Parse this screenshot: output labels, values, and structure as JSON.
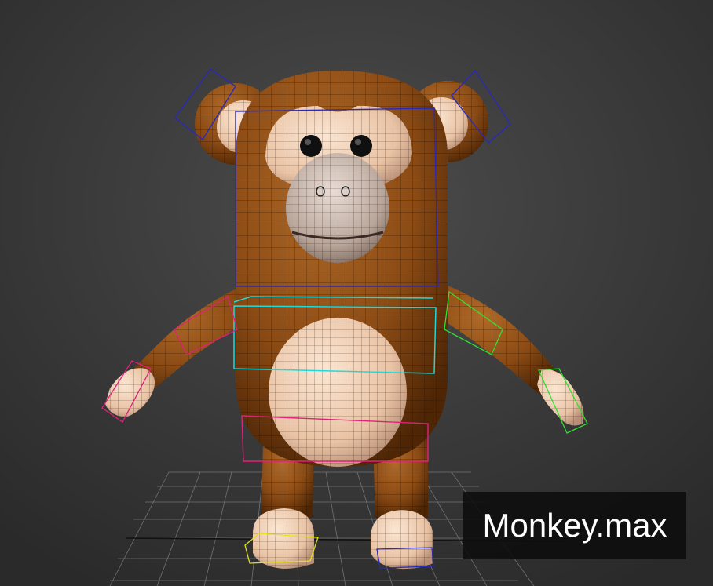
{
  "scene": {
    "file_name": "Monkey.max",
    "object": "monkey-character",
    "colors": {
      "background_top": "#4a4a4a",
      "background_bottom": "#2c2c2c",
      "fur": "#8a4a14",
      "fur_dark": "#5a2c08",
      "skin": "#f4d2b4",
      "skin_shade": "#c89f86",
      "eye": "#111111",
      "bone_blue": "#2a2ab8",
      "bone_cyan": "#22d8d8",
      "bone_pink": "#e0207a",
      "bone_green": "#30e030",
      "bone_yellow": "#e0e020",
      "grid": "#9a9a9a",
      "label_text": "#ffffff"
    }
  }
}
